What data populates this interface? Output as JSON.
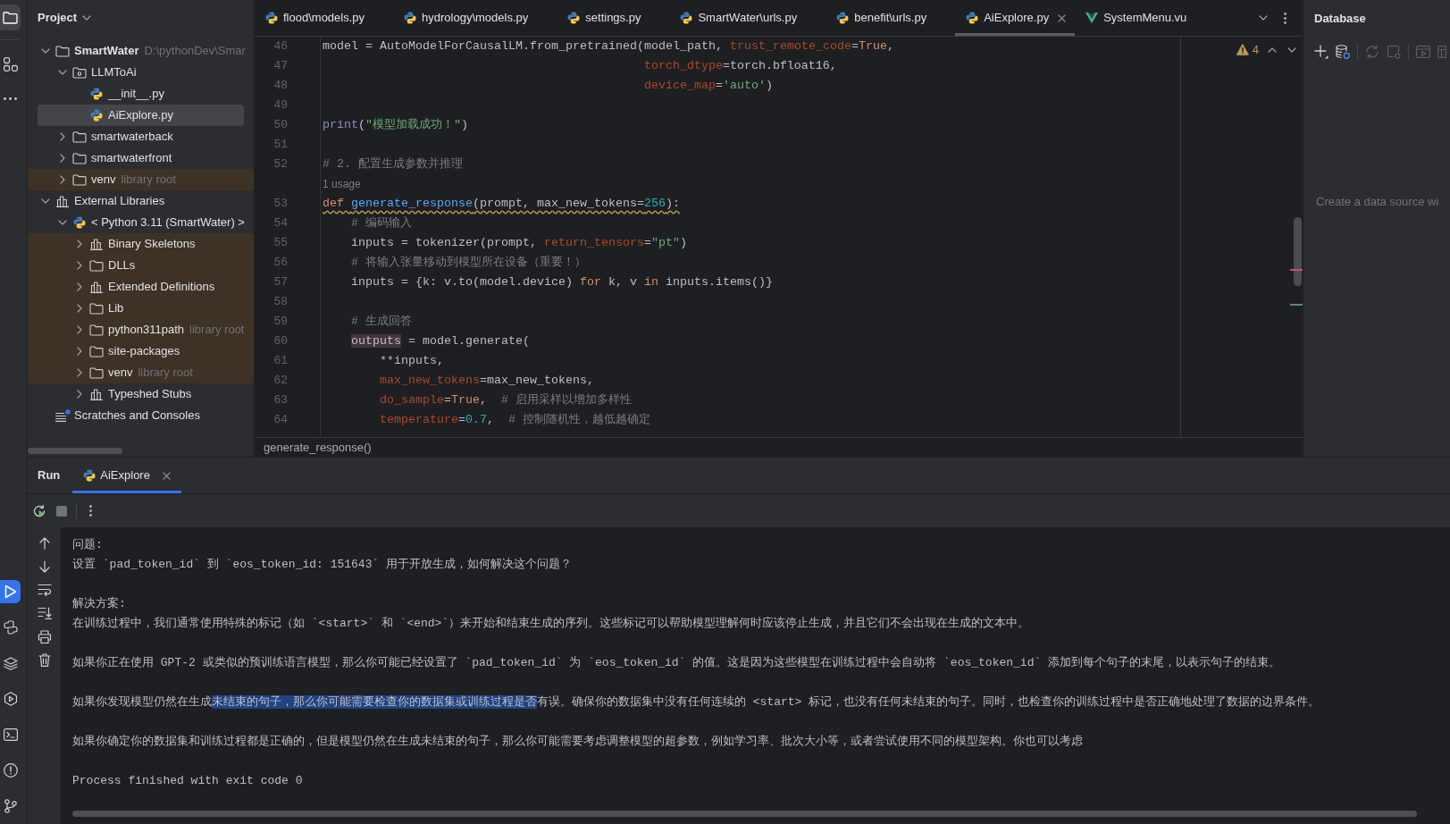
{
  "tool_strip": {
    "top": [
      {
        "selected": true
      },
      {
        "selected": false
      },
      {
        "selected": false
      }
    ],
    "bottom": [
      {
        "selected": true
      },
      {
        "selected": false
      },
      {
        "selected": false
      },
      {
        "selected": false
      },
      {
        "selected": false
      },
      {
        "selected": false
      },
      {
        "selected": false
      }
    ]
  },
  "project": {
    "title": "Project",
    "tree": [
      {
        "label": "SmartWater",
        "kind": "project",
        "hint": "D:\\pythonDev\\Smar",
        "expanded": true,
        "selected": false,
        "library": false,
        "children": [
          {
            "label": "LLMToAi",
            "kind": "package",
            "expanded": true,
            "selected": false,
            "library": false,
            "children": [
              {
                "label": "__init__.py",
                "kind": "python",
                "selected": false,
                "library": false
              },
              {
                "label": "AiExplore.py",
                "kind": "python",
                "selected": true,
                "library": false
              }
            ]
          },
          {
            "label": "smartwaterback",
            "kind": "folder",
            "expanded": false,
            "selected": false,
            "library": false
          },
          {
            "label": "smartwaterfront",
            "kind": "folder",
            "expanded": false,
            "selected": false,
            "library": false
          },
          {
            "label": "venv",
            "kind": "folder",
            "hint": "library root",
            "expanded": false,
            "selected": false,
            "library": true
          }
        ]
      },
      {
        "label": "External Libraries",
        "kind": "library",
        "expanded": true,
        "selected": false,
        "library": false,
        "children": [
          {
            "label": "< Python 3.11 (SmartWater) >",
            "kind": "python",
            "expanded": true,
            "selected": false,
            "library": false,
            "children": [
              {
                "label": "Binary Skeletons",
                "kind": "library",
                "expanded": false,
                "selected": false,
                "library": true
              },
              {
                "label": "DLLs",
                "kind": "folder",
                "expanded": false,
                "selected": false,
                "library": true
              },
              {
                "label": "Extended Definitions",
                "kind": "library",
                "expanded": false,
                "selected": false,
                "library": true
              },
              {
                "label": "Lib",
                "kind": "folder",
                "expanded": false,
                "selected": false,
                "library": true
              },
              {
                "label": "python311path",
                "kind": "folder",
                "hint": "library root",
                "expanded": false,
                "selected": false,
                "library": true
              },
              {
                "label": "site-packages",
                "kind": "folder",
                "expanded": false,
                "selected": false,
                "library": true
              },
              {
                "label": "venv",
                "kind": "folder",
                "hint": "library root",
                "expanded": false,
                "selected": false,
                "library": true
              },
              {
                "label": "Typeshed Stubs",
                "kind": "library",
                "expanded": false,
                "selected": false,
                "library": false
              }
            ]
          }
        ]
      },
      {
        "label": "Scratches and Consoles",
        "kind": "scratches",
        "selected": false,
        "library": false
      }
    ]
  },
  "editor": {
    "tabs": [
      {
        "label": "flood\\models.py",
        "kind": "python",
        "selected": false
      },
      {
        "label": "hydrology\\models.py",
        "kind": "python",
        "selected": false
      },
      {
        "label": "settings.py",
        "kind": "python",
        "selected": false
      },
      {
        "label": "SmartWater\\urls.py",
        "kind": "python",
        "selected": false
      },
      {
        "label": "benefit\\urls.py",
        "kind": "python",
        "selected": false
      },
      {
        "label": "AiExplore.py",
        "kind": "python",
        "selected": true
      },
      {
        "label": "SystemMenu.vu",
        "kind": "vue",
        "selected": false
      }
    ],
    "warnings": "4",
    "lines": [
      {
        "number": "46",
        "warning": false,
        "tokens": [
          {
            "text": "model = AutoModelForCausalLM.from_pretrained(model_path, ",
            "kind": "plain"
          },
          {
            "text": "trust_remote_code",
            "kind": "param"
          },
          {
            "text": "=",
            "kind": "plain"
          },
          {
            "text": "True",
            "kind": "keyword"
          },
          {
            "text": ",",
            "kind": "plain"
          }
        ]
      },
      {
        "number": "47",
        "warning": false,
        "tokens": [
          {
            "text": "                                             torch_dtype",
            "kind": "param"
          },
          {
            "text": "=torch.bfloat16,",
            "kind": "plain"
          }
        ]
      },
      {
        "number": "48",
        "warning": false,
        "tokens": [
          {
            "text": "                                             device_map",
            "kind": "param"
          },
          {
            "text": "=",
            "kind": "plain"
          },
          {
            "text": "'auto'",
            "kind": "string"
          },
          {
            "text": ")",
            "kind": "plain"
          }
        ]
      },
      {
        "number": "49",
        "warning": false
      },
      {
        "number": "50",
        "warning": false,
        "tokens": [
          {
            "text": "print",
            "kind": "builtin"
          },
          {
            "text": "(",
            "kind": "plain"
          },
          {
            "text": "\"模型加载成功！\"",
            "kind": "string"
          },
          {
            "text": ")",
            "kind": "plain"
          }
        ]
      },
      {
        "number": "51",
        "warning": false
      },
      {
        "number": "52",
        "warning": false,
        "tokens": [
          {
            "text": "# 2. 配置生成参数并推理",
            "kind": "comment"
          }
        ]
      },
      {
        "number": "53",
        "warning": true,
        "hint": "1 usage",
        "tokens": [
          {
            "text": "def ",
            "kind": "keyword"
          },
          {
            "text": "generate_response",
            "kind": "function"
          },
          {
            "text": "(prompt, max_new_tokens=",
            "kind": "plain"
          },
          {
            "text": "256",
            "kind": "number"
          },
          {
            "text": "):",
            "kind": "plain"
          }
        ]
      },
      {
        "number": "54",
        "warning": false,
        "tokens": [
          {
            "text": "    # 编码输入",
            "kind": "comment"
          }
        ]
      },
      {
        "number": "55",
        "warning": false,
        "tokens": [
          {
            "text": "    inputs = tokenizer(prompt, ",
            "kind": "plain"
          },
          {
            "text": "return_tensors",
            "kind": "param"
          },
          {
            "text": "=",
            "kind": "plain"
          },
          {
            "text": "\"pt\"",
            "kind": "string"
          },
          {
            "text": ")",
            "kind": "plain"
          }
        ]
      },
      {
        "number": "56",
        "warning": false,
        "tokens": [
          {
            "text": "    # 将输入张量移动到模型所在设备（重要！）",
            "kind": "comment"
          }
        ]
      },
      {
        "number": "57",
        "warning": false,
        "tokens": [
          {
            "text": "    inputs = {k: v.to(model.device) ",
            "kind": "plain"
          },
          {
            "text": "for",
            "kind": "keyword"
          },
          {
            "text": " k, v ",
            "kind": "plain"
          },
          {
            "text": "in",
            "kind": "keyword"
          },
          {
            "text": " inputs.items()}",
            "kind": "plain"
          }
        ]
      },
      {
        "number": "58",
        "warning": false
      },
      {
        "number": "59",
        "warning": false,
        "tokens": [
          {
            "text": "    # 生成回答",
            "kind": "comment"
          }
        ]
      },
      {
        "number": "60",
        "warning": false,
        "tokens": [
          {
            "text": "    outputs",
            "kind": "usage"
          },
          {
            "text": " = model.generate(",
            "kind": "plain"
          }
        ]
      },
      {
        "number": "61",
        "warning": false,
        "tokens": [
          {
            "text": "        **inputs,",
            "kind": "plain"
          }
        ]
      },
      {
        "number": "62",
        "warning": false,
        "tokens": [
          {
            "text": "        max_new_tokens",
            "kind": "param"
          },
          {
            "text": "=max_new_tokens,",
            "kind": "plain"
          }
        ]
      },
      {
        "number": "63",
        "warning": false,
        "tokens": [
          {
            "text": "        do_sample",
            "kind": "param"
          },
          {
            "text": "=",
            "kind": "plain"
          },
          {
            "text": "True",
            "kind": "keyword"
          },
          {
            "text": ",  ",
            "kind": "plain"
          },
          {
            "text": "# 启用采样以增加多样性",
            "kind": "comment"
          }
        ]
      },
      {
        "number": "64",
        "warning": false,
        "tokens": [
          {
            "text": "        temperature",
            "kind": "param"
          },
          {
            "text": "=",
            "kind": "plain"
          },
          {
            "text": "0.7",
            "kind": "number"
          },
          {
            "text": ",  ",
            "kind": "plain"
          },
          {
            "text": "# 控制随机性，越低越确定",
            "kind": "comment"
          }
        ]
      }
    ],
    "breadcrumb": "generate_response()"
  },
  "database": {
    "title": "Database",
    "toolbar": [
      {
        "disabled": false
      },
      {
        "disabled": false
      },
      {
        "disabled": true
      },
      {
        "disabled": true
      },
      {
        "disabled": true
      },
      {
        "disabled": true
      }
    ],
    "message": "Create a data source wi"
  },
  "run": {
    "title": "Run",
    "tabs": [
      {
        "label": "AiExplore",
        "selected": true
      }
    ],
    "toolbar": [
      {
        "disabled": false
      },
      {
        "disabled": true
      },
      {
        "disabled": false
      }
    ],
    "console": [
      [
        {
          "text": "问题:"
        },
        {
          "text": "设置 `pad_token_id` 到 `eos_token_id: 151643` 用于开放生成，如何解决这个问题？"
        }
      ],
      [
        {
          "text": "解决方案:"
        },
        {
          "text": "在训练过程中，我们通常使用特殊的标记（如 `<start>` 和 `<end>`）来开始和结束生成的序列。这些标记可以帮助模型理解何时应该停止生成，并且它们不会出现在生成的文本中。"
        }
      ],
      [
        {
          "text": "如果你正在使用 GPT-2 或类似的预训练语言模型，那么你可能已经设置了 `pad_token_id` 为 `eos_token_id` 的值。这是因为这些模型在训练过程中会自动将 `eos_token_id` 添加到每个句子的末尾，以表示句子的结束。"
        }
      ],
      [
        {
          "segments": [
            {
              "text": "如果你发现模型仍然在生成",
              "selected": false
            },
            {
              "text": "未结束的句子，那么你可能需要检查你的数据集或训练过程是否",
              "selected": true
            },
            {
              "text": "有误。确保你的数据集中没有任何连续的 <start> 标记，也没有任何未结束的句子。同时，也检查你的训练过程中是否正确地处理了数据的边界条件。",
              "selected": false
            }
          ]
        }
      ],
      [
        {
          "text": "如果你确定你的数据集和训练过程都是正确的，但是模型仍然在生成未结束的句子，那么你可能需要考虑调整模型的超参数，例如学习率、批次大小等，或者尝试使用不同的模型架构。你也可以考虑"
        }
      ],
      [
        {
          "text": "Process finished with exit code 0"
        }
      ]
    ]
  }
}
